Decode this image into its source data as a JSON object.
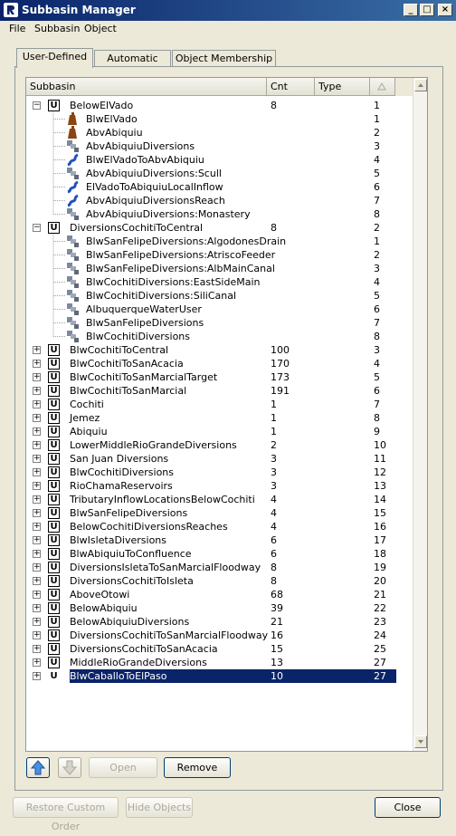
{
  "window": {
    "title": "Subbasin Manager",
    "controls": [
      "_",
      "□",
      "×"
    ]
  },
  "menu": [
    "File",
    "Subbasin",
    "Object"
  ],
  "tabs": [
    {
      "label": "User-Defined",
      "active": true
    },
    {
      "label": "Automatic",
      "active": false
    },
    {
      "label": "Object Membership",
      "active": false
    }
  ],
  "table": {
    "columns": [
      "Subbasin",
      "Cnt",
      "Type"
    ],
    "rows": [
      {
        "level": 0,
        "expander": "−",
        "icon": "U",
        "name": "BelowElVado",
        "cnt": "8",
        "num": "1"
      },
      {
        "level": 1,
        "icon": "reservoir",
        "name": "BlwElVado",
        "cnt": "",
        "num": "1"
      },
      {
        "level": 1,
        "icon": "reservoir",
        "name": "AbvAbiquiu",
        "cnt": "",
        "num": "2"
      },
      {
        "level": 1,
        "icon": "diversion",
        "name": "AbvAbiquiuDiversions",
        "cnt": "",
        "num": "3"
      },
      {
        "level": 1,
        "icon": "reach",
        "name": "BlwElVadoToAbvAbiquiu",
        "cnt": "",
        "num": "4"
      },
      {
        "level": 1,
        "icon": "diversion",
        "name": "AbvAbiquiuDiversions:Scull",
        "cnt": "",
        "num": "5"
      },
      {
        "level": 1,
        "icon": "reach",
        "name": "ElVadoToAbiquiuLocalInflow",
        "cnt": "",
        "num": "6"
      },
      {
        "level": 1,
        "icon": "reach",
        "name": "AbvAbiquiuDiversionsReach",
        "cnt": "",
        "num": "7"
      },
      {
        "level": 1,
        "icon": "diversion",
        "name": "AbvAbiquiuDiversions:Monastery",
        "cnt": "",
        "num": "8"
      },
      {
        "level": 0,
        "expander": "−",
        "icon": "U",
        "name": "DiversionsCochitiToCentral",
        "cnt": "8",
        "num": "2"
      },
      {
        "level": 1,
        "icon": "diversion",
        "name": "BlwSanFelipeDiversions:AlgodonesDrain",
        "cnt": "",
        "num": "1"
      },
      {
        "level": 1,
        "icon": "diversion",
        "name": "BlwSanFelipeDiversions:AtriscoFeeder",
        "cnt": "",
        "num": "2"
      },
      {
        "level": 1,
        "icon": "diversion",
        "name": "BlwSanFelipeDiversions:AlbMainCanal",
        "cnt": "",
        "num": "3"
      },
      {
        "level": 1,
        "icon": "diversion",
        "name": "BlwCochitiDiversions:EastSideMain",
        "cnt": "",
        "num": "4"
      },
      {
        "level": 1,
        "icon": "diversion",
        "name": "BlwCochitiDiversions:SiliCanal",
        "cnt": "",
        "num": "5"
      },
      {
        "level": 1,
        "icon": "diversion",
        "name": "AlbuquerqueWaterUser",
        "cnt": "",
        "num": "6"
      },
      {
        "level": 1,
        "icon": "diversion",
        "name": "BlwSanFelipeDiversions",
        "cnt": "",
        "num": "7"
      },
      {
        "level": 1,
        "icon": "diversion",
        "name": "BlwCochitiDiversions",
        "cnt": "",
        "num": "8"
      },
      {
        "level": 0,
        "expander": "+",
        "icon": "U",
        "name": "BlwCochitiToCentral",
        "cnt": "100",
        "num": "3"
      },
      {
        "level": 0,
        "expander": "+",
        "icon": "U",
        "name": "BlwCochitiToSanAcacia",
        "cnt": "170",
        "num": "4"
      },
      {
        "level": 0,
        "expander": "+",
        "icon": "U",
        "name": "BlwCochitiToSanMarcialTarget",
        "cnt": "173",
        "num": "5"
      },
      {
        "level": 0,
        "expander": "+",
        "icon": "U",
        "name": "BlwCochitiToSanMarcial",
        "cnt": "191",
        "num": "6"
      },
      {
        "level": 0,
        "expander": "+",
        "icon": "U",
        "name": "Cochiti",
        "cnt": "1",
        "num": "7"
      },
      {
        "level": 0,
        "expander": "+",
        "icon": "U",
        "name": "Jemez",
        "cnt": "1",
        "num": "8"
      },
      {
        "level": 0,
        "expander": "+",
        "icon": "U",
        "name": "Abiquiu",
        "cnt": "1",
        "num": "9"
      },
      {
        "level": 0,
        "expander": "+",
        "icon": "U",
        "name": "LowerMiddleRioGrandeDiversions",
        "cnt": "2",
        "num": "10"
      },
      {
        "level": 0,
        "expander": "+",
        "icon": "U",
        "name": "San Juan Diversions",
        "cnt": "3",
        "num": "11"
      },
      {
        "level": 0,
        "expander": "+",
        "icon": "U",
        "name": "BlwCochitiDiversions",
        "cnt": "3",
        "num": "12"
      },
      {
        "level": 0,
        "expander": "+",
        "icon": "U",
        "name": "RioChamaReservoirs",
        "cnt": "3",
        "num": "13"
      },
      {
        "level": 0,
        "expander": "+",
        "icon": "U",
        "name": "TributaryInflowLocationsBelowCochiti",
        "cnt": "4",
        "num": "14"
      },
      {
        "level": 0,
        "expander": "+",
        "icon": "U",
        "name": "BlwSanFelipeDiversions",
        "cnt": "4",
        "num": "15"
      },
      {
        "level": 0,
        "expander": "+",
        "icon": "U",
        "name": "BelowCochitiDiversionsReaches",
        "cnt": "4",
        "num": "16"
      },
      {
        "level": 0,
        "expander": "+",
        "icon": "U",
        "name": "BlwIsletaDiversions",
        "cnt": "6",
        "num": "17"
      },
      {
        "level": 0,
        "expander": "+",
        "icon": "U",
        "name": "BlwAbiquiuToConfluence",
        "cnt": "6",
        "num": "18"
      },
      {
        "level": 0,
        "expander": "+",
        "icon": "U",
        "name": "DiversionsIsletaToSanMarcialFloodway",
        "cnt": "8",
        "num": "19"
      },
      {
        "level": 0,
        "expander": "+",
        "icon": "U",
        "name": "DiversionsCochitiToIsleta",
        "cnt": "8",
        "num": "20"
      },
      {
        "level": 0,
        "expander": "+",
        "icon": "U",
        "name": "AboveOtowi",
        "cnt": "68",
        "num": "21"
      },
      {
        "level": 0,
        "expander": "+",
        "icon": "U",
        "name": "BelowAbiquiu",
        "cnt": "39",
        "num": "22"
      },
      {
        "level": 0,
        "expander": "+",
        "icon": "U",
        "name": "BelowAbiquiuDiversions",
        "cnt": "21",
        "num": "23"
      },
      {
        "level": 0,
        "expander": "+",
        "icon": "U",
        "name": "DiversionsCochitiToSanMarcialFloodway",
        "cnt": "16",
        "num": "24"
      },
      {
        "level": 0,
        "expander": "+",
        "icon": "U",
        "name": "DiversionsCochitiToSanAcacia",
        "cnt": "15",
        "num": "25"
      },
      {
        "level": 0,
        "expander": "+",
        "icon": "U",
        "name": "MiddleRioGrandeDiversions",
        "cnt": "13",
        "num": "27"
      },
      {
        "level": 0,
        "expander": "+",
        "icon": "U",
        "name": "BlwCaballoToElPaso",
        "cnt": "10",
        "num": "27",
        "selected": true
      }
    ]
  },
  "buttons": {
    "open": "Open",
    "remove": "Remove",
    "restore": "Restore Custom Order",
    "hide": "Hide Objects",
    "close": "Close"
  },
  "colors": {
    "selection": "#0a246a",
    "title_bar": "#0a246a"
  }
}
